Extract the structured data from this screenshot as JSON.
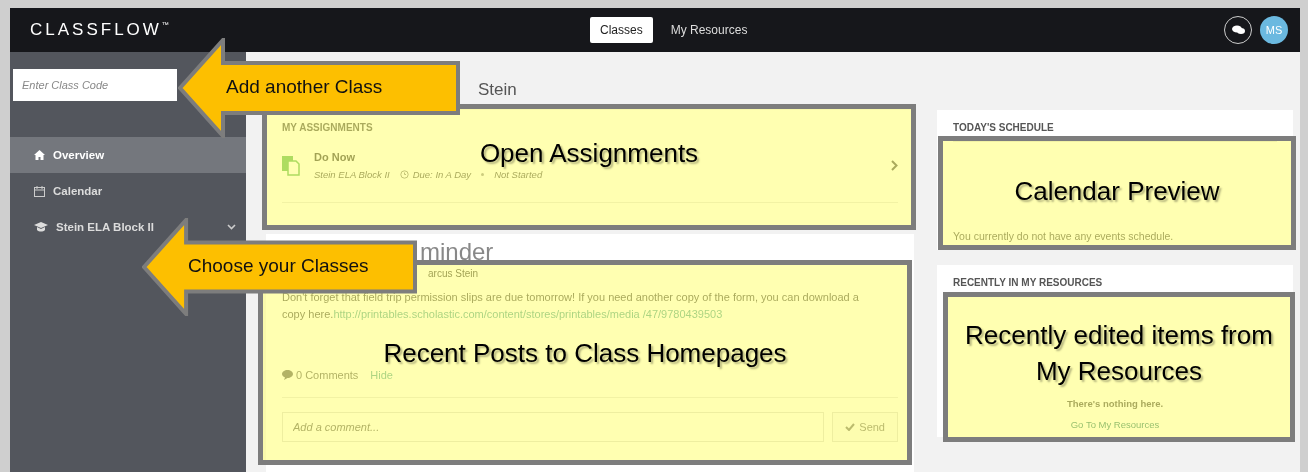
{
  "app": {
    "logo": "CLASSFLOW",
    "logo_mark": "™"
  },
  "nav_tabs": [
    {
      "label": "Classes",
      "selected": true
    },
    {
      "label": "My Resources",
      "selected": false
    }
  ],
  "avatar": {
    "initials": "MS"
  },
  "sidebar": {
    "class_code": {
      "placeholder": "Enter Class Code"
    },
    "items": [
      {
        "label": "Overview",
        "kind": "home",
        "selected": true,
        "expandable": false
      },
      {
        "label": "Calendar",
        "kind": "calendar",
        "selected": false,
        "expandable": false
      },
      {
        "label": "Stein ELA Block II",
        "kind": "class",
        "selected": false,
        "expandable": true
      }
    ]
  },
  "page_heading": "Stein",
  "assignments": {
    "title": "MY ASSIGNMENTS",
    "items": [
      {
        "title": "Do Now",
        "class": "Stein ELA Block II",
        "due": "Due: In A Day",
        "status": "Not Started"
      }
    ]
  },
  "post": {
    "title": "minder",
    "byline": "arcus Stein",
    "body": "Don't forget that field trip permission slips are due tomorrow! If you need another copy of the form, you can download a copy here.",
    "link": "http://printables.scholastic.com/content/stores/printables/media /47/9780439503",
    "comments": "0 Comments",
    "hide": "Hide",
    "comment_field": {
      "placeholder": "Add a comment..."
    },
    "send": "Send"
  },
  "schedule": {
    "title": "TODAY'S SCHEDULE",
    "empty": "You currently do not have any events schedule."
  },
  "resources": {
    "title": "RECENTLY IN MY RESOURCES",
    "empty": "There's nothing here.",
    "link": "Go To My Resources"
  },
  "annotations": [
    {
      "kind": "arrow",
      "text": "Add another Class"
    },
    {
      "kind": "arrow",
      "text": "Choose your Classes"
    },
    {
      "kind": "highlight",
      "text": "Open Assignments"
    },
    {
      "kind": "highlight",
      "text": "Recent Posts to Class Homepages"
    },
    {
      "kind": "highlight",
      "text": "Calendar Preview"
    },
    {
      "kind": "highlight",
      "text": "Recently edited items from My Resources"
    }
  ]
}
